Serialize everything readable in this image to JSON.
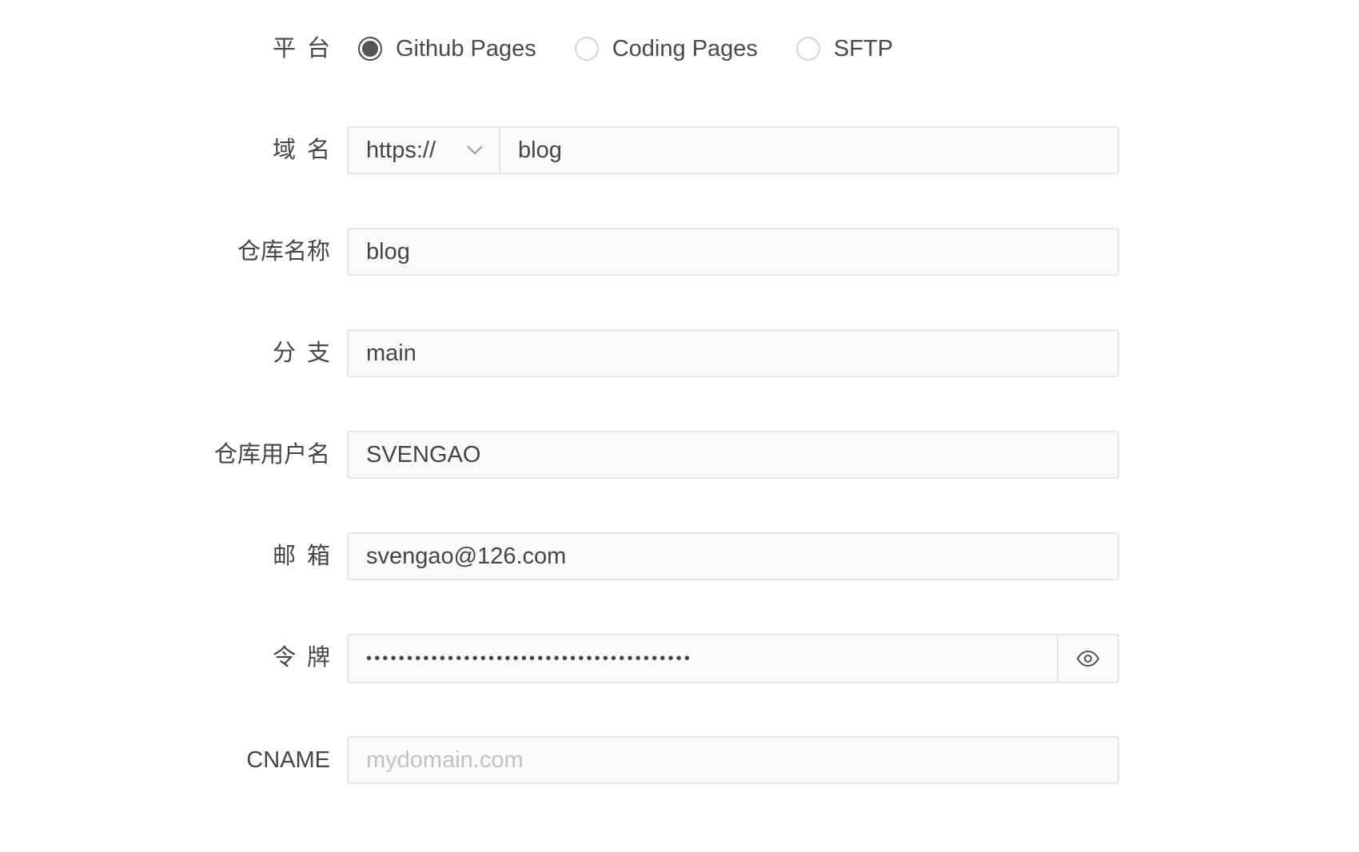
{
  "form": {
    "platform": {
      "label": "平台",
      "options": [
        {
          "label": "Github Pages",
          "checked": true
        },
        {
          "label": "Coding Pages",
          "checked": false
        },
        {
          "label": "SFTP",
          "checked": false
        }
      ]
    },
    "domain": {
      "label": "域名",
      "protocol": "https://",
      "value": "blog"
    },
    "repository": {
      "label": "仓库名称",
      "value": "blog"
    },
    "branch": {
      "label": "分支",
      "value": "main"
    },
    "username": {
      "label": "仓库用户名",
      "value": "SVENGAO"
    },
    "email": {
      "label": "邮箱",
      "value": "svengao@126.com"
    },
    "token": {
      "label": "令牌",
      "value": "••••••••••••••••••••••••••••••••••••••••",
      "toggle_icon": "eye-icon"
    },
    "cname": {
      "label": "CNAME",
      "value": "",
      "placeholder": "mydomain.com"
    }
  }
}
